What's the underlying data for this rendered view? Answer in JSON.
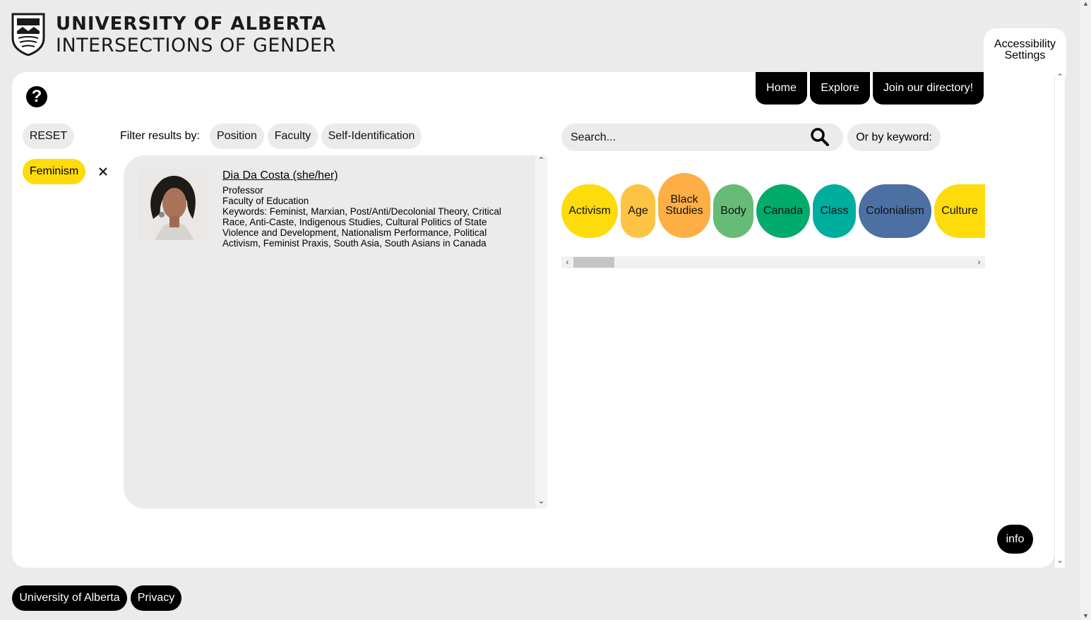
{
  "header": {
    "university": "UNIVERSITY OF ALBERTA",
    "site_name": "INTERSECTIONS OF GENDER",
    "accessibility_label": "Accessibility Settings"
  },
  "nav": {
    "home": "Home",
    "explore": "Explore",
    "join": "Join our directory!"
  },
  "filters": {
    "reset_label": "RESET",
    "filter_by_label": "Filter results by:",
    "position": "Position",
    "faculty": "Faculty",
    "self_identification": "Self-Identification",
    "active_tag": "Feminism",
    "remove_icon": "close-icon"
  },
  "result": {
    "name": "Dia Da Costa (she/her)",
    "position": "Professor",
    "faculty": "Faculty of Education",
    "keywords": "Keywords: Feminist, Marxian, Post/Anti/Decolonial Theory, Critical Race, Anti-Caste, Indigenous Studies, Cultural Politics of State Violence and Development, Nationalism Performance, Political Activism, Feminist Praxis, South Asia, South Asians in Canada"
  },
  "search": {
    "placeholder": "Search...",
    "keyword_label": "Or by keyword:"
  },
  "keywords": [
    {
      "label": "Activism",
      "color": "#fedb0b"
    },
    {
      "label": "Age",
      "color": "#fdc443"
    },
    {
      "label": "Black Studies",
      "color": "#fdae45"
    },
    {
      "label": "Body",
      "color": "#66bb77"
    },
    {
      "label": "Canada",
      "color": "#00ab6c"
    },
    {
      "label": "Class",
      "color": "#00ae9e"
    },
    {
      "label": "Colonialism",
      "color": "#4d70a3"
    },
    {
      "label": "Culture",
      "color": "#fedb0b"
    }
  ],
  "info_label": "info",
  "footer": {
    "university": "University of Alberta",
    "privacy": "Privacy"
  }
}
